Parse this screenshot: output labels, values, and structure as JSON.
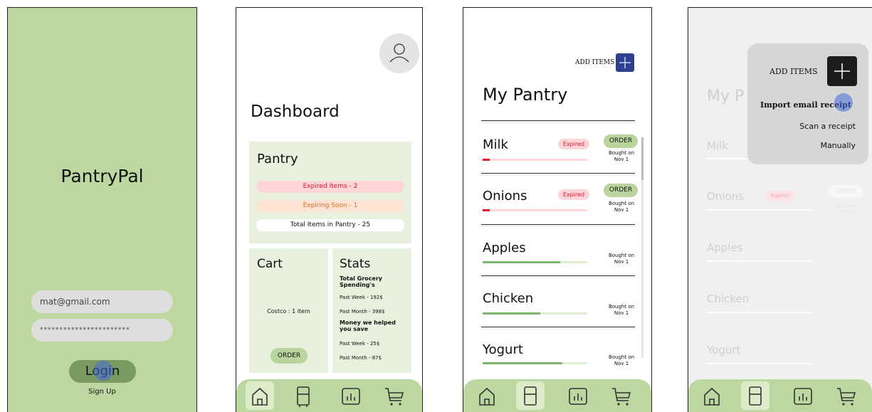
{
  "screen1": {
    "app_title": "PantryPal",
    "email_value": "mat@gmail.com",
    "password_value": "***********************",
    "login_label": "Login",
    "signup_label": "Sign Up"
  },
  "screen2": {
    "page_title": "Dashboard",
    "pantry_title": "Pantry",
    "expired_items": "Expired Items - 2",
    "expiring_soon": "Expiring Soon - 1",
    "total_items": "Total Items in Pantry - 25",
    "cart_title": "Cart",
    "cart_store": "Costco : 1 item",
    "order_label": "ORDER",
    "stats_title": "Stats",
    "spending_heading": "Total Grocery Spending's",
    "spending_week": "Past Week - 192$",
    "spending_month": "Past Month - 398$",
    "saved_heading": "Money we helped you save",
    "saved_week": "Past Week - 25$",
    "saved_month": "Past Month - 87$"
  },
  "screen3": {
    "add_items_label": "ADD ITEMS",
    "page_title": "My Pantry",
    "items": [
      {
        "name": "Milk",
        "badge": "Expired",
        "order": "ORDER",
        "bought_line1": "Bought on",
        "bought_line2": "Nov 1",
        "freshness": 0.07,
        "color": "#e0142b"
      },
      {
        "name": "Onions",
        "badge": "Expired",
        "order": "ORDER",
        "bought_line1": "Bought on",
        "bought_line2": "Nov 1",
        "freshness": 0.07,
        "color": "#e0142b"
      },
      {
        "name": "Apples",
        "bought_line1": "Bought on",
        "bought_line2": "Nov 1",
        "freshness": 0.74,
        "color": "#7db56a"
      },
      {
        "name": "Chicken",
        "bought_line1": "Bought on",
        "bought_line2": "Nov 1",
        "freshness": 0.55,
        "color": "#7db56a"
      },
      {
        "name": "Yogurt",
        "bought_line1": "Bought on",
        "bought_line2": "Nov 1",
        "freshness": 0.76,
        "color": "#7db56a"
      }
    ]
  },
  "screen4": {
    "menu_title": "ADD ITEMS",
    "option_import": "Import email receipt",
    "option_scan": "Scan a receipt",
    "option_manual": "Manually",
    "bg_title": "My P",
    "bg_items": [
      "Milk",
      "Onions",
      "Apples",
      "Chicken",
      "Yogurt"
    ],
    "bg_badge": "Expired",
    "bg_order": "ORDER",
    "bg_bought_line1": "Bought on",
    "bg_bought_line2": "Nov 1"
  },
  "nav_icons": [
    "home-icon",
    "fridge-icon",
    "stats-icon",
    "cart-icon"
  ],
  "colors": {
    "accent_green": "#bcd7a0",
    "expired_red": "#e0142b",
    "expiring_orange": "#e86a1c"
  }
}
